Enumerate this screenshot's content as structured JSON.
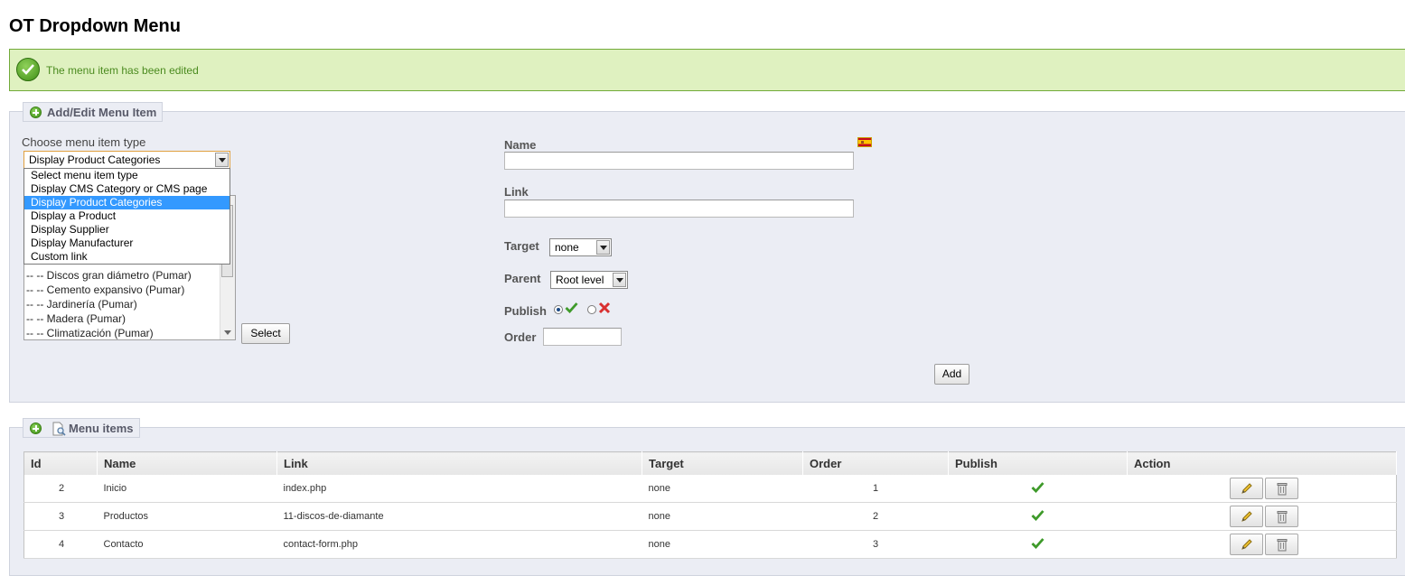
{
  "page": {
    "title": "OT Dropdown Menu"
  },
  "alert": {
    "message": "The menu item has been edited",
    "color": "#dff1c0"
  },
  "add_edit": {
    "legend": "Add/Edit Menu Item",
    "type_label": "Choose menu item type",
    "type_selected": "Display Product Categories",
    "type_options": [
      "Select menu item type",
      "Display CMS Category or CMS page",
      "Display Product Categories",
      "Display a Product",
      "Display Supplier",
      "Display Manufacturer",
      "Custom link"
    ],
    "category_list": [
      "-- -- Discos gran diámetro (Pumar)",
      "-- -- Cemento expansivo (Pumar)",
      "-- -- Jardinería (Pumar)",
      "-- -- Madera (Pumar)",
      "-- -- Climatización (Pumar)"
    ],
    "select_button": "Select",
    "name_label": "Name",
    "name_value": "",
    "link_label": "Link",
    "link_value": "",
    "target_label": "Target",
    "target_value": "none",
    "parent_label": "Parent",
    "parent_value": "Root level",
    "publish_label": "Publish",
    "publish_value": "yes",
    "order_label": "Order",
    "order_value": "",
    "add_button": "Add",
    "language_flag": "spain-flag-icon"
  },
  "menu_items": {
    "legend": "Menu items",
    "columns": [
      "Id",
      "Name",
      "Link",
      "Target",
      "Order",
      "Publish",
      "Action"
    ],
    "rows": [
      {
        "id": "2",
        "name": "Inicio",
        "link": "index.php",
        "target": "none",
        "order": "1",
        "publish": true
      },
      {
        "id": "3",
        "name": "Productos",
        "link": "11-discos-de-diamante",
        "target": "none",
        "order": "2",
        "publish": true
      },
      {
        "id": "4",
        "name": "Contacto",
        "link": "contact-form.php",
        "target": "none",
        "order": "3",
        "publish": true
      }
    ]
  }
}
